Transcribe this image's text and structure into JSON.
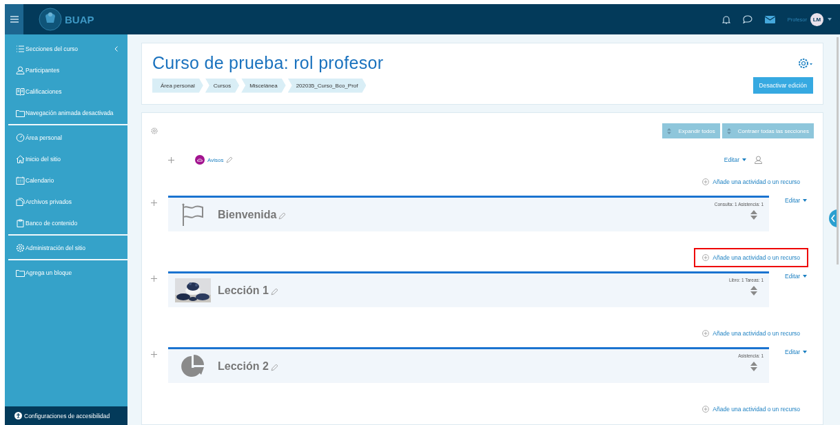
{
  "navbar": {
    "brand": "BUAP",
    "user_name": "Profesor",
    "avatar_initials": "LM"
  },
  "sidebar": {
    "groups": [
      {
        "items": [
          {
            "label": "Secciones del curso",
            "kind": "toggle"
          },
          {
            "label": "Participantes",
            "kind": "link"
          },
          {
            "label": "Calificaciones",
            "kind": "link"
          },
          {
            "label": "Navegación animada desactivada",
            "kind": "link"
          }
        ]
      },
      {
        "items": [
          {
            "label": "Área personal",
            "kind": "link"
          },
          {
            "label": "Inicio del sitio",
            "kind": "link"
          },
          {
            "label": "Calendario",
            "kind": "link"
          },
          {
            "label": "Archivos privados",
            "kind": "link"
          },
          {
            "label": "Banco de contenido",
            "kind": "link"
          }
        ]
      },
      {
        "items": [
          {
            "label": "Administración del sitio",
            "kind": "link"
          }
        ]
      },
      {
        "items": [
          {
            "label": "Agrega un bloque",
            "kind": "link"
          }
        ]
      }
    ],
    "footer": "Configuraciones de accesibilidad"
  },
  "header": {
    "title": "Curso de prueba: rol profesor",
    "breadcrumb": [
      "Área personal",
      "Cursos",
      "Miscelánea",
      "202035_Curso_Bco_Prof"
    ],
    "edit_button": "Desactivar edición"
  },
  "content": {
    "buttons": [
      "Expandir todos",
      "Contraer todas las secciones"
    ],
    "general": {
      "activity": "Avisos",
      "edit": "Editar",
      "add": {
        "label": "Añade una actividad o un recurso",
        "highlighted": false
      }
    },
    "sections": [
      {
        "title": "Bienvenida",
        "kind": "flag",
        "summary": "Consulta: 1 Asistencia: 1",
        "edit": "Editar",
        "add": {
          "label": "Añade una actividad o un recurso",
          "highlighted": true
        }
      },
      {
        "title": "Lección 1",
        "kind": "picture",
        "summary": "Libro: 1 Tareas: 1",
        "edit": "Editar",
        "add": {
          "label": "Añade una actividad o un recurso",
          "highlighted": false
        }
      },
      {
        "title": "Lección 2",
        "kind": "pie",
        "summary": "Asistencia: 1",
        "edit": "Editar",
        "add": {
          "label": "Añade una actividad o un recurso",
          "highlighted": false
        }
      }
    ]
  }
}
